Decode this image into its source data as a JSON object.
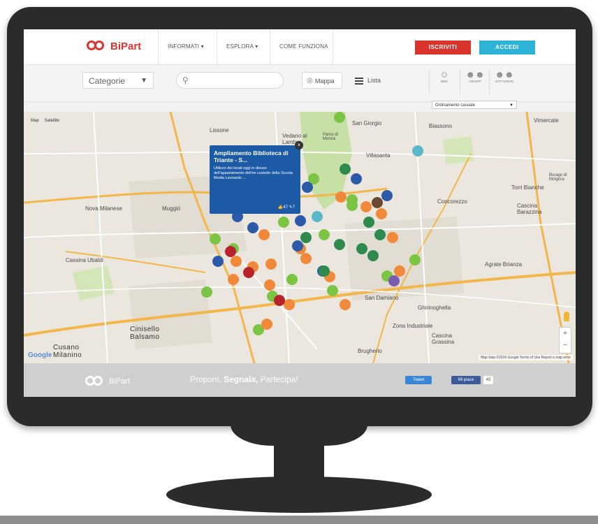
{
  "brand": {
    "name": "BiPart",
    "color": "#e0342f"
  },
  "nav": {
    "items": [
      {
        "label": "INFORMATI",
        "chevron": "▾"
      },
      {
        "label": "ESPLORA",
        "chevron": "▾"
      },
      {
        "label": "COME FUNZIONA",
        "chevron": ""
      }
    ],
    "signup_label": "ISCRIVITI",
    "login_label": "ACCEDI"
  },
  "toolbar": {
    "category_label": "Categorie",
    "search_placeholder": "",
    "view_map_label": "Mappa",
    "view_list_label": "Lista",
    "filters": [
      {
        "label": "IDEE",
        "icon": "idea-people-icon"
      },
      {
        "label": "GRUPPI",
        "icon": "groups-icon"
      },
      {
        "label": "ISTITUZIONI",
        "icon": "institutions-icon"
      }
    ],
    "order_label": "Ordinamento casuale"
  },
  "map": {
    "type_map": "Map",
    "type_satellite": "Satellite",
    "places": [
      {
        "name": "Lissone"
      },
      {
        "name": "Vedano al Lambro"
      },
      {
        "name": "San Giorgio"
      },
      {
        "name": "Villasanta"
      },
      {
        "name": "Parco di Monza"
      },
      {
        "name": "Brugherio"
      },
      {
        "name": "Nova Milanese"
      },
      {
        "name": "Muggiò"
      },
      {
        "name": "Cinisello Balsamo"
      },
      {
        "name": "Cusano Milanino"
      },
      {
        "name": "Cassina Ubaldi"
      },
      {
        "name": "San Damiano"
      },
      {
        "name": "Agrate Brianza"
      },
      {
        "name": "Concorezzo"
      },
      {
        "name": "Vimercate"
      },
      {
        "name": "Torri Bianche"
      },
      {
        "name": "Cascina Barazzina"
      },
      {
        "name": "Zona Industriale"
      },
      {
        "name": "Cascina Grassina"
      },
      {
        "name": "Ghirinoghella"
      },
      {
        "name": "Biassono"
      },
      {
        "name": "Burago di Molgora"
      }
    ],
    "popup": {
      "title": "Ampliamento Biblioteca di Triante - S...",
      "description": "Utilizzo dei locali oggi in disuso dell'appartamento dell'ex custode della Scuola Media Leonardo ...",
      "likes": "47",
      "comments": "7"
    },
    "google_logo": "Google",
    "attribution": "Map data ©2016 Google   Terms of Use   Report a map error",
    "marker_colors": {
      "green": "#7cc443",
      "orange": "#f08a3a",
      "blue": "#2d5aa8",
      "dark_green": "#2f8a4e",
      "red": "#b8222c",
      "cyan": "#5bb8c9",
      "purple": "#7a5bb0",
      "brown": "#6a4a30"
    }
  },
  "footer": {
    "brand": "BiPart",
    "slogan_1": "Proponi,",
    "slogan_2": "Segnala,",
    "slogan_3": "Partecipa!",
    "tweet_label": "Tweet",
    "fb_label": "Mi piace",
    "fb_count": "45"
  }
}
